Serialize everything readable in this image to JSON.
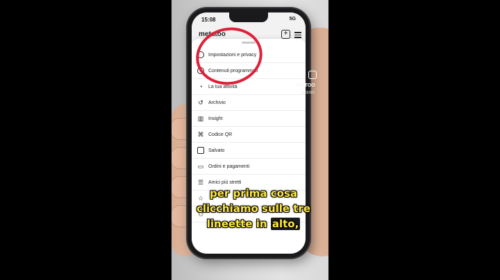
{
  "status_bar": {
    "time": "15:08",
    "network": "5G"
  },
  "app": {
    "logo": "metatoo"
  },
  "menu": [
    {
      "label": "Impostazioni e privacy",
      "icon": "settings-icon"
    },
    {
      "label": "Contenuti programmati",
      "icon": "clock-icon"
    },
    {
      "label": "La tua attività",
      "icon": "activity-icon"
    },
    {
      "label": "Archivio",
      "icon": "archive-icon"
    },
    {
      "label": "Insight",
      "icon": "insights-icon"
    },
    {
      "label": "Codice QR",
      "icon": "qr-code-icon"
    },
    {
      "label": "Salvato",
      "icon": "bookmark-icon"
    },
    {
      "label": "Ordini e pagamenti",
      "icon": "card-icon"
    },
    {
      "label": "Amici più stretti",
      "icon": "list-icon"
    },
    {
      "label": "",
      "icon": "star-icon"
    },
    {
      "label": "",
      "icon": "people-icon"
    }
  ],
  "overlay": {
    "watermark": "TATTOO",
    "watermark_sub": "...anzoni"
  },
  "caption": {
    "line1": "per prima cosa",
    "line2": "clicchiamo sulle tre",
    "line3_a": "lineette in ",
    "line3_b": "alto,"
  },
  "colors": {
    "circle_highlight": "#e0203a",
    "caption_text": "#ffe93a"
  }
}
